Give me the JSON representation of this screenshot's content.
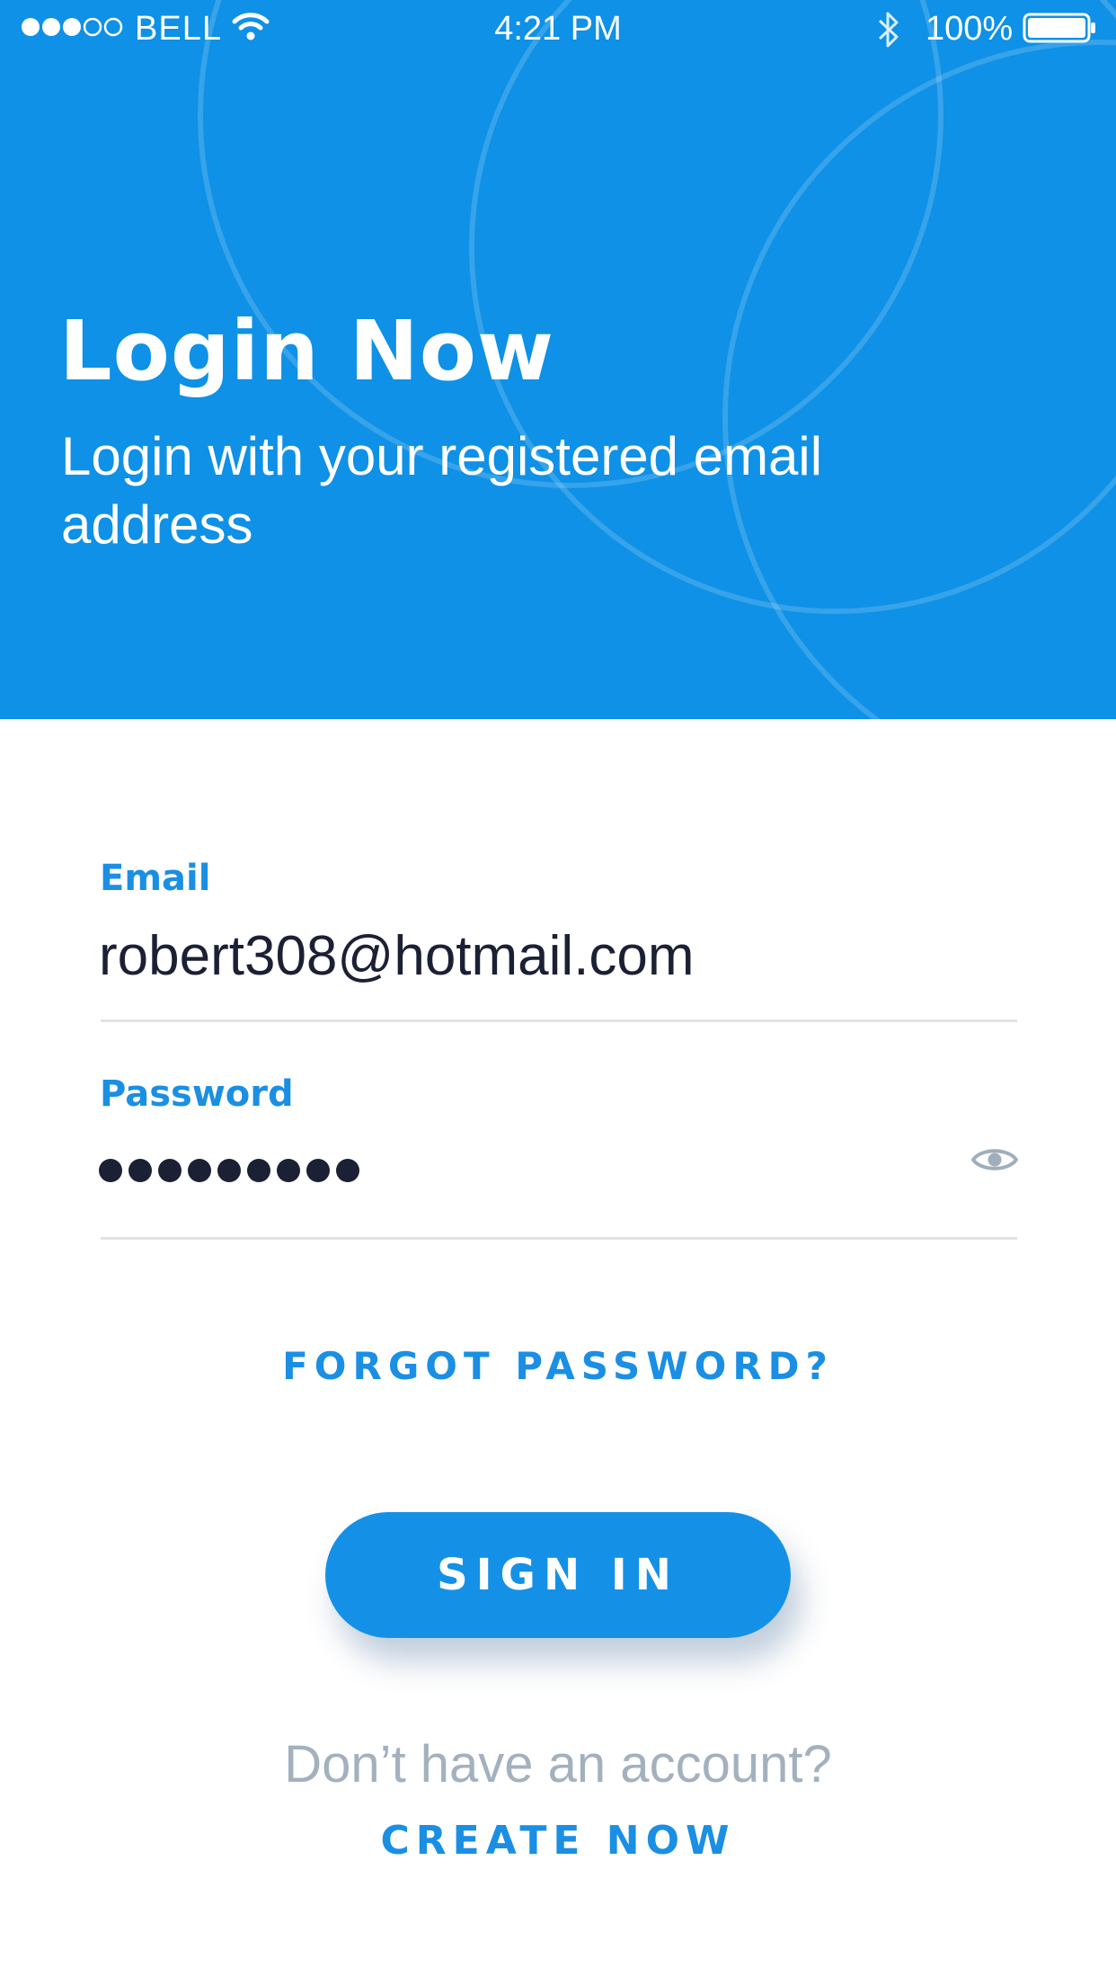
{
  "status_bar": {
    "carrier": "BELL",
    "time": "4:21 PM",
    "battery": "100%",
    "icons": {
      "signal": "signal-strength-icon",
      "wifi": "wifi-icon",
      "bluetooth": "bluetooth-icon",
      "battery": "battery-icon"
    }
  },
  "header": {
    "title": "Login Now",
    "subtitle": "Login with your registered email address"
  },
  "form": {
    "email_label": "Email",
    "email_value": "robert308@hotmail.com",
    "password_label": "Password",
    "password_mask": "●●●●●●●●●",
    "password_toggle_icon": "eye-icon"
  },
  "actions": {
    "forgot_password": "FORGOT PASSWORD?",
    "sign_in": "SIGN IN",
    "no_account": "Don’t have an account?",
    "create_now": "CREATE NOW"
  },
  "colors": {
    "primary": "#0e91e6",
    "accent_text": "#1a8fe3",
    "dark_text": "#1b2035",
    "muted_text": "#a3b1bf",
    "divider": "#dfe3e6"
  }
}
